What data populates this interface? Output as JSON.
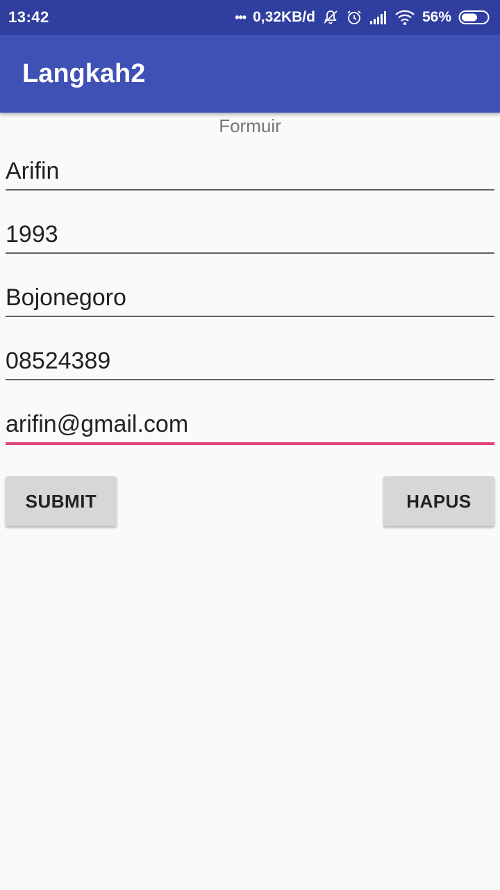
{
  "status_bar": {
    "time": "13:42",
    "more_dots": "•••",
    "network_speed": "0,32KB/d",
    "battery_percent": "56%",
    "icons": [
      "overflow-dots-icon",
      "notifications-off-icon",
      "alarm-icon",
      "signal-icon",
      "wifi-icon",
      "battery-icon"
    ]
  },
  "app_bar": {
    "title": "Langkah2",
    "color": "#3f51b5"
  },
  "form": {
    "title": "Formuir",
    "fields": [
      {
        "value": "Arifin"
      },
      {
        "value": "1993"
      },
      {
        "value": "Bojonegoro"
      },
      {
        "value": "08524389"
      },
      {
        "value": "arifin@gmail.com"
      }
    ],
    "focus_color": "#e0457b"
  },
  "buttons": {
    "submit_label": "SUBMIT",
    "hapus_label": "HAPUS"
  }
}
